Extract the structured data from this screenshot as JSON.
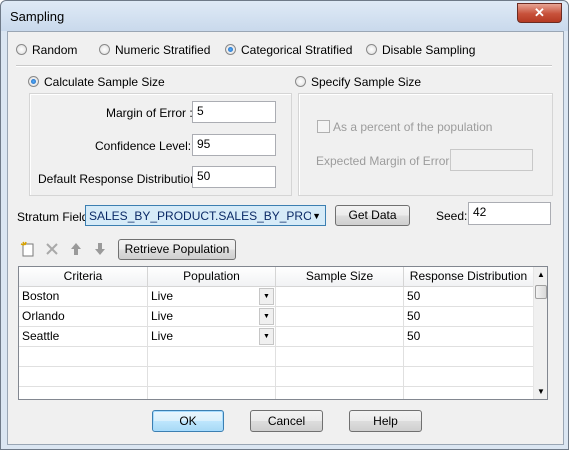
{
  "window": {
    "title": "Sampling",
    "close_glyph": "✕"
  },
  "sampling_mode": {
    "options": [
      "Random",
      "Numeric Stratified",
      "Categorical Stratified",
      "Disable Sampling"
    ],
    "selected": "Categorical Stratified"
  },
  "sample_size": {
    "calculate_label": "Calculate Sample Size",
    "specify_label": "Specify Sample Size",
    "selected": "Calculate Sample Size",
    "margin_of_error_label": "Margin of Error :",
    "margin_of_error_value": "5",
    "confidence_level_label": "Confidence Level:",
    "confidence_level_value": "95",
    "default_response_label": "Default Response Distribution:",
    "default_response_value": "50",
    "as_percent_label": "As a percent of the population",
    "expected_margin_label": "Expected Margin of Error:",
    "expected_margin_value": ""
  },
  "stratum": {
    "label": "Stratum Field:",
    "value": "SALES_BY_PRODUCT.SALES_BY_PRODUCT",
    "get_data_label": "Get Data",
    "seed_label": "Seed:",
    "seed_value": "42"
  },
  "toolbar": {
    "retrieve_label": "Retrieve Population",
    "icons": [
      "new-row-icon",
      "delete-icon",
      "move-up-icon",
      "move-down-icon"
    ]
  },
  "table": {
    "columns": [
      "Criteria",
      "Population",
      "Sample Size",
      "Response Distribution"
    ],
    "rows": [
      {
        "criteria": "Boston",
        "population": "Live",
        "sample_size": "",
        "response": "50"
      },
      {
        "criteria": "Orlando",
        "population": "Live",
        "sample_size": "",
        "response": "50"
      },
      {
        "criteria": "Seattle",
        "population": "Live",
        "sample_size": "",
        "response": "50"
      }
    ]
  },
  "buttons": {
    "ok": "OK",
    "cancel": "Cancel",
    "help": "Help"
  }
}
